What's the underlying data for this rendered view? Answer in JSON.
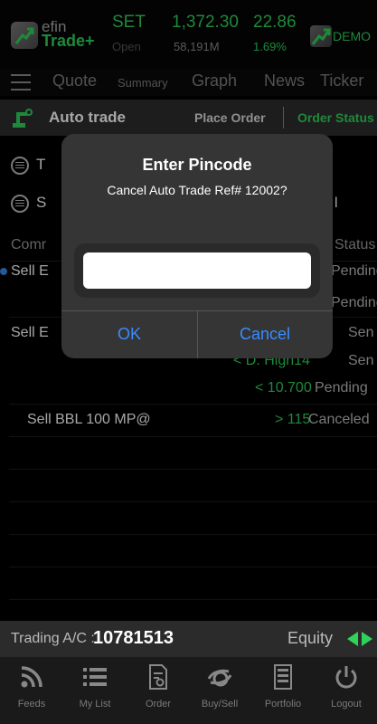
{
  "header": {
    "logo_top": "efin",
    "logo_bottom": "Trade+",
    "index_name": "SET",
    "index_state": "Open",
    "index_value": "1,372.30",
    "index_volume": "58,191M",
    "index_change": "22.86",
    "index_change_pct": "1.69%",
    "mode": "DEMO"
  },
  "nav": {
    "tabs": [
      "Quote",
      "Summary",
      "Graph",
      "News",
      "Ticker"
    ]
  },
  "autobar": {
    "title": "Auto trade",
    "place_order": "Place Order",
    "order_status": "Order Status"
  },
  "background": {
    "filter1": "T",
    "filter2": "S",
    "filter2_right": "l",
    "col_left": "Comr",
    "col_right": "Status",
    "rows": [
      {
        "left": "Sell E",
        "right": "Pending"
      },
      {
        "left": "",
        "right": "Pending"
      },
      {
        "left": "Sell E",
        "right": "Sen"
      },
      {
        "left": "",
        "mid": "< D. High14",
        "right": "Sen"
      },
      {
        "left": "",
        "mid": "< 10.700",
        "right": "Pending"
      },
      {
        "left": "Sell BBL 100 MP@",
        "mid": "> 115",
        "right": "Canceled"
      }
    ]
  },
  "dialog": {
    "title": "Enter Pincode",
    "message": "Cancel Auto Trade Ref# 12002?",
    "pin_value": "",
    "ok": "OK",
    "cancel": "Cancel"
  },
  "account": {
    "label": "Trading A/C :",
    "number": "10781513",
    "type": "Equity"
  },
  "tabbar": {
    "items": [
      "Feeds",
      "My List",
      "Order",
      "Buy/Sell",
      "Portfolio",
      "Logout"
    ]
  },
  "colors": {
    "accent_green": "#2fd35a",
    "link_blue": "#3a8cff",
    "panel": "#353535"
  }
}
